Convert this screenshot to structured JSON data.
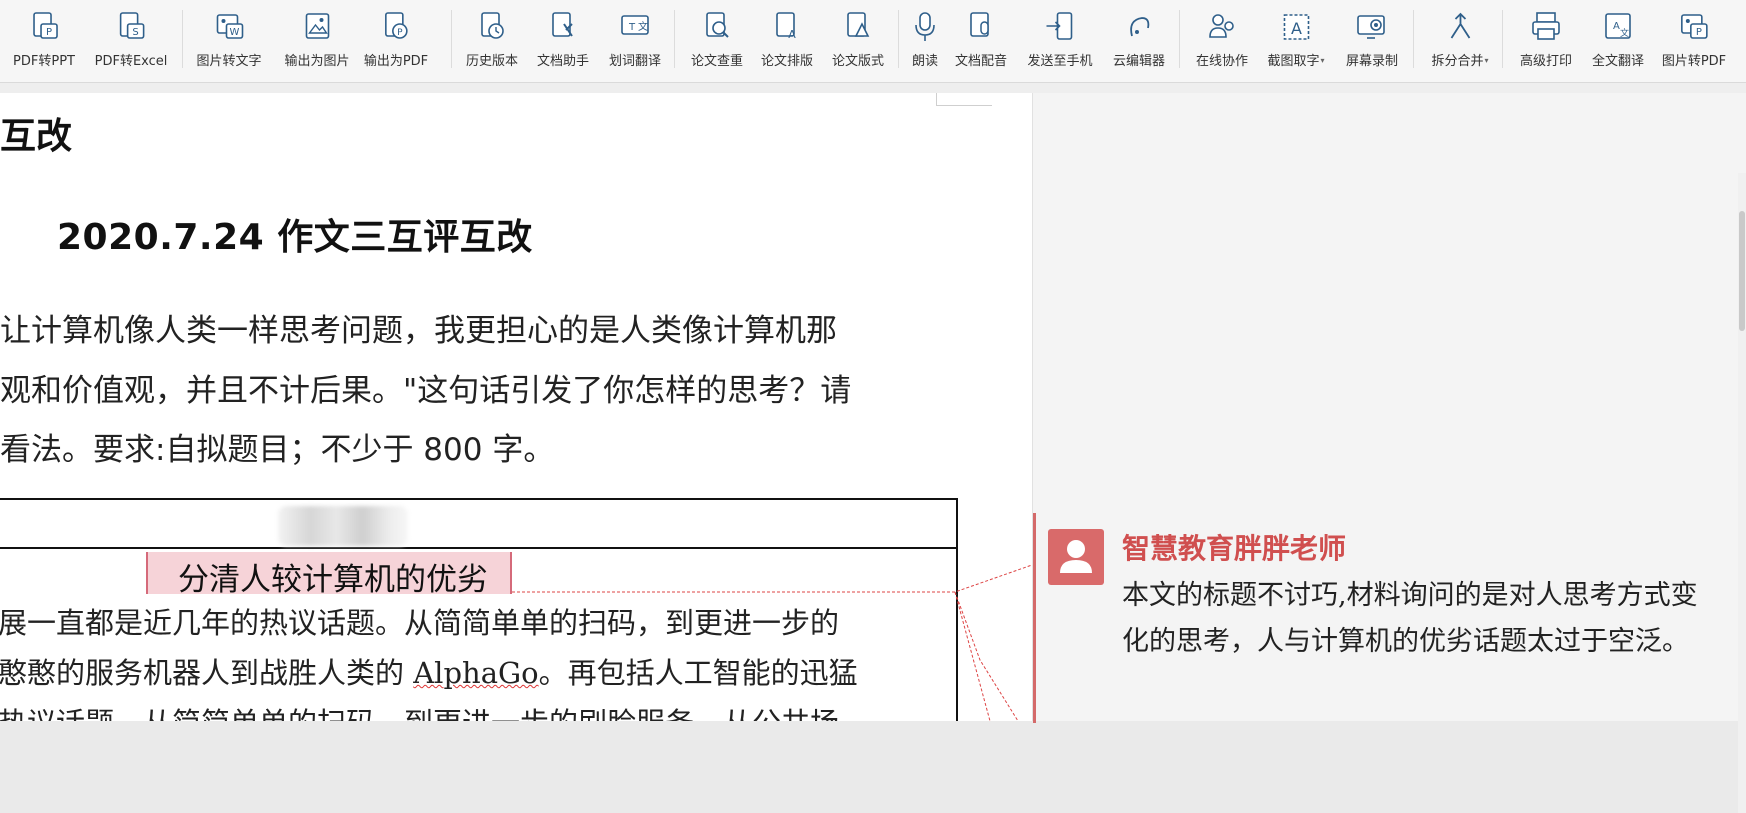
{
  "toolbar": {
    "items": [
      {
        "label": "PDF转PPT",
        "icon": "pdf-to-ppt-icon"
      },
      {
        "label": "PDF转Excel",
        "icon": "pdf-to-excel-icon"
      },
      {
        "label": "图片转文字",
        "icon": "image-to-text-icon"
      },
      {
        "label": "输出为图片",
        "icon": "export-image-icon"
      },
      {
        "label": "输出为PDF",
        "icon": "export-pdf-icon"
      },
      {
        "label": "历史版本",
        "icon": "history-version-icon"
      },
      {
        "label": "文档助手",
        "icon": "doc-assistant-icon"
      },
      {
        "label": "划词翻译",
        "icon": "word-translate-icon"
      },
      {
        "label": "论文查重",
        "icon": "paper-check-icon"
      },
      {
        "label": "论文排版",
        "icon": "paper-layout-icon"
      },
      {
        "label": "论文版式",
        "icon": "paper-format-icon"
      },
      {
        "label": "朗读",
        "icon": "read-aloud-icon"
      },
      {
        "label": "文档配音",
        "icon": "doc-voiceover-icon"
      },
      {
        "label": "发送至手机",
        "icon": "send-to-phone-icon"
      },
      {
        "label": "云编辑器",
        "icon": "cloud-editor-icon"
      },
      {
        "label": "在线协作",
        "icon": "online-collab-icon"
      },
      {
        "label": "截图取字",
        "icon": "screenshot-text-icon",
        "dropdown": true
      },
      {
        "label": "屏幕录制",
        "icon": "screen-record-icon"
      },
      {
        "label": "拆分合并",
        "icon": "split-merge-icon",
        "dropdown": true
      },
      {
        "label": "高级打印",
        "icon": "advanced-print-icon"
      },
      {
        "label": "全文翻译",
        "icon": "full-translate-icon"
      },
      {
        "label": "图片转PDF",
        "icon": "image-to-pdf-icon"
      }
    ],
    "dropdown_caret": "▾"
  },
  "document": {
    "heading_fragment": "互改",
    "title": "2020.7.24 作文三互评互改",
    "prompt_lines": [
      "让计算机像人类一样思考问题，我更担心的是人类像计算机那",
      "观和价值观，并且不计后果。\"这句话引发了你怎样的思考？请",
      "看法。要求:自拟题目；不少于 800 字。"
    ],
    "essay_title": "分清人较计算机的优劣",
    "essay_lines": [
      [
        "展一直都是近几年的热议话题。从简简单单的扫码，到更进一步的"
      ],
      [
        "憨憨的服务机器人到战胜人类的 ",
        "AlphaGo",
        "。再包括人工智能的迅猛"
      ],
      [
        "热议话题。从简简单单的扫码，到更进一步的刷脸服务，从公共场"
      ]
    ]
  },
  "comment": {
    "author": "智慧教育胖胖老师",
    "lines": [
      "本文的标题不讨巧,材料询问的是对人思考方式变",
      "化的思考，人与计算机的优劣话题太过于空泛。"
    ],
    "accent_color": "#d04f4f"
  },
  "colors": {
    "highlight": "#f6d3d8",
    "toolbar_icon": "#2f5f8a"
  }
}
